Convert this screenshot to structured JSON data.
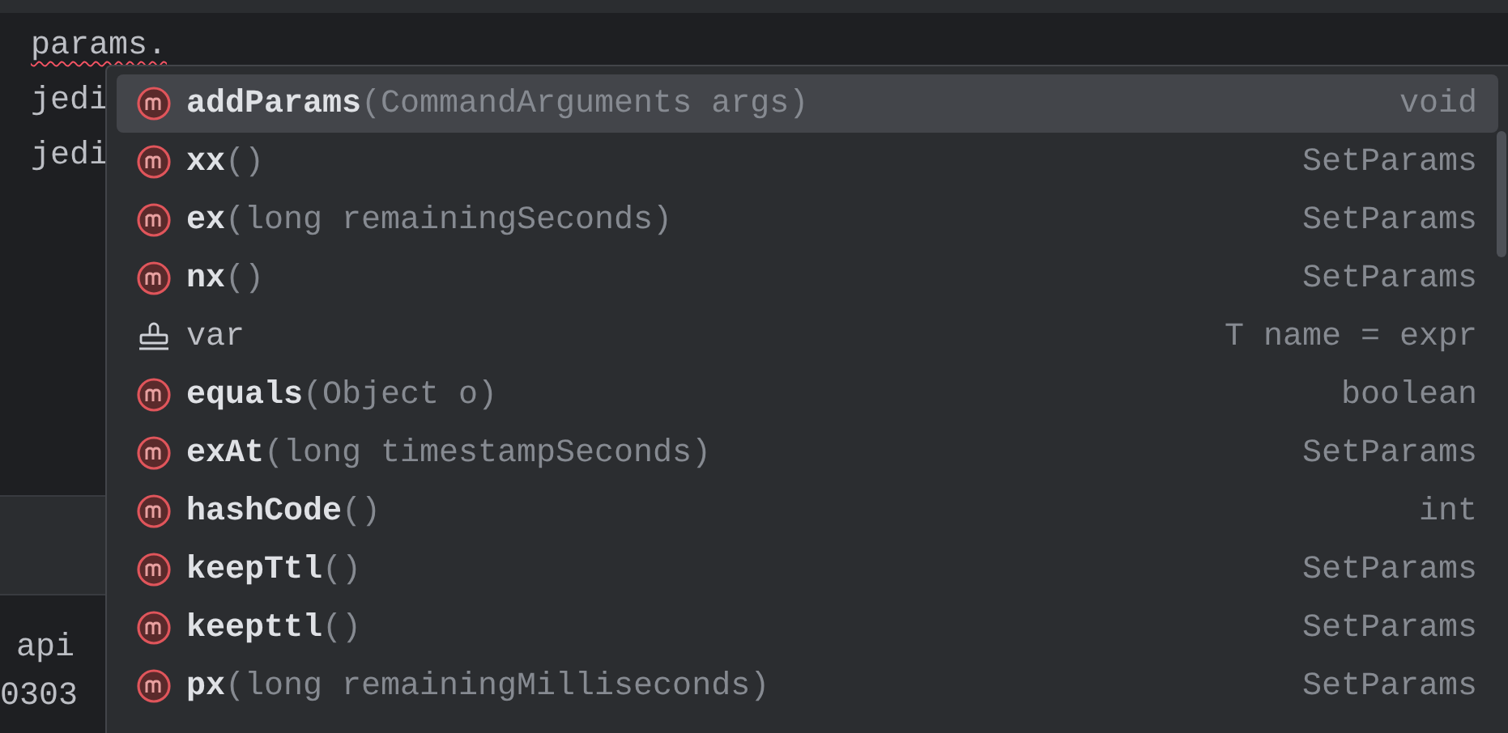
{
  "editor": {
    "lines": [
      {
        "text": "params.",
        "error": true
      },
      {
        "text": "jedi",
        "error": false
      },
      {
        "text": "jedi",
        "error": false
      }
    ],
    "lower_lines": [
      {
        "text": "api"
      },
      {
        "text": "0303"
      }
    ]
  },
  "completion": {
    "items": [
      {
        "kind": "method",
        "name": "addParams",
        "signature": "(CommandArguments args)",
        "type": "void",
        "selected": true
      },
      {
        "kind": "method",
        "name": "xx",
        "signature": "()",
        "type": "SetParams",
        "selected": false
      },
      {
        "kind": "method",
        "name": "ex",
        "signature": "(long remainingSeconds)",
        "type": "SetParams",
        "selected": false
      },
      {
        "kind": "method",
        "name": "nx",
        "signature": "()",
        "type": "SetParams",
        "selected": false
      },
      {
        "kind": "template",
        "name": "var",
        "type": "T name = expr",
        "selected": false
      },
      {
        "kind": "method",
        "name": "equals",
        "signature": "(Object o)",
        "type": "boolean",
        "selected": false
      },
      {
        "kind": "method",
        "name": "exAt",
        "signature": "(long timestampSeconds)",
        "type": "SetParams",
        "selected": false
      },
      {
        "kind": "method",
        "name": "hashCode",
        "signature": "()",
        "type": "int",
        "selected": false
      },
      {
        "kind": "method",
        "name": "keepTtl",
        "signature": "()",
        "type": "SetParams",
        "selected": false
      },
      {
        "kind": "method",
        "name": "keepttl",
        "signature": "()",
        "type": "SetParams",
        "selected": false
      },
      {
        "kind": "method",
        "name": "px",
        "signature": "(long remainingMilliseconds)",
        "type": "SetParams",
        "selected": false
      }
    ]
  }
}
